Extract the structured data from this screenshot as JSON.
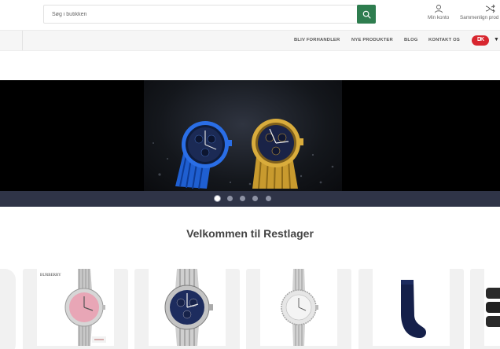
{
  "header": {
    "search_placeholder": "Søg i butikken",
    "account_label": "Min konto",
    "compare_label": "Sammenlign prod"
  },
  "nav": {
    "links": [
      "BLIV FORHANDLER",
      "NYE PRODUKTER",
      "BLOG",
      "KONTAKT OS"
    ],
    "language_flag": "DK"
  },
  "slider": {
    "slide_count": 5,
    "active_slide": 1
  },
  "main": {
    "welcome_title": "Velkommen til Restlager"
  },
  "products": [
    {
      "name": "pink-dial-watch",
      "brand_text": "BURBERRY"
    },
    {
      "name": "blue-dial-chronograph-watch"
    },
    {
      "name": "silver-crystal-watch"
    },
    {
      "name": "navy-socks"
    },
    {
      "name": "black-socks"
    }
  ],
  "colors": {
    "accent_green": "#2e7d4f",
    "flag_red": "#d8262f",
    "slider_bar": "#2f3447"
  }
}
